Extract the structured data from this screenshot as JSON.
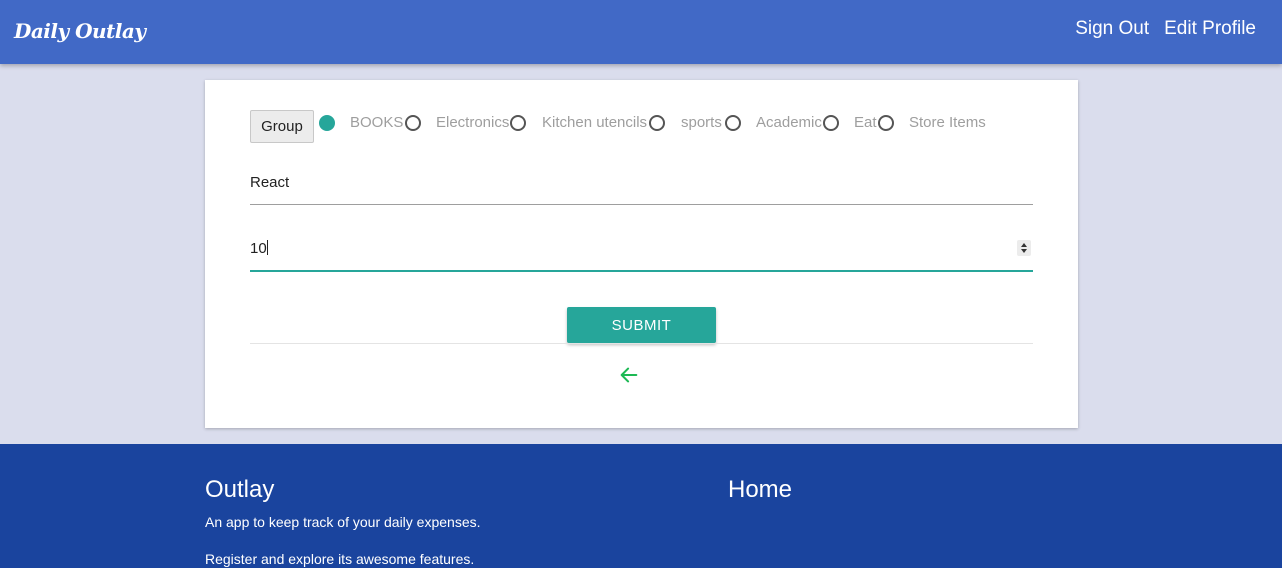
{
  "navbar": {
    "brand": "Daily Outlay",
    "links": [
      "Sign Out",
      "Edit Profile"
    ]
  },
  "form": {
    "group_button": "Group",
    "categories": [
      {
        "label": "BOOKS",
        "selected": true
      },
      {
        "label": "Electronics",
        "selected": false
      },
      {
        "label": "Kitchen utencils",
        "selected": false
      },
      {
        "label": "sports",
        "selected": false
      },
      {
        "label": "Academic",
        "selected": false
      },
      {
        "label": "Eat",
        "selected": false
      },
      {
        "label": "Store Items",
        "selected": false
      }
    ],
    "name_value": "React",
    "amount_value": "10",
    "submit_label": "SUBMIT",
    "back_icon": "arrow-left-icon"
  },
  "footer": {
    "title": "Outlay",
    "line1": "An app to keep track of your daily expenses.",
    "line2": "Register and explore its awesome features.",
    "home_link": "Home"
  },
  "colors": {
    "navbar": "#4169c6",
    "accent": "#26a69a",
    "footer": "#1a449e",
    "background": "#dadded",
    "arrow": "#1db954"
  }
}
